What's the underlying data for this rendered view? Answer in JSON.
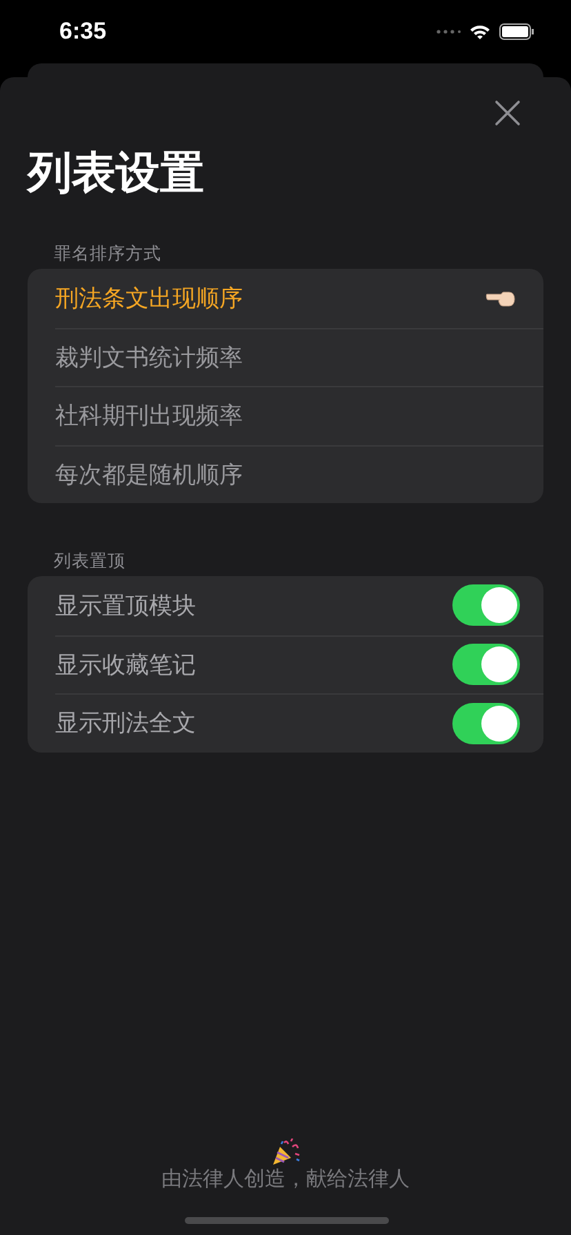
{
  "status_bar": {
    "time": "6:35"
  },
  "title": "列表设置",
  "sort_section": {
    "header": "罪名排序方式",
    "options": [
      {
        "label": "刑法条文出现顺序",
        "selected": true
      },
      {
        "label": "裁判文书统计频率",
        "selected": false
      },
      {
        "label": "社科期刊出现频率",
        "selected": false
      },
      {
        "label": "每次都是随机顺序",
        "selected": false
      }
    ]
  },
  "pin_section": {
    "header": "列表置顶",
    "toggles": [
      {
        "label": "显示置顶模块",
        "on": true
      },
      {
        "label": "显示收藏笔记",
        "on": true
      },
      {
        "label": "显示刑法全文",
        "on": true
      }
    ]
  },
  "footer": "由法律人创造，献给法律人"
}
